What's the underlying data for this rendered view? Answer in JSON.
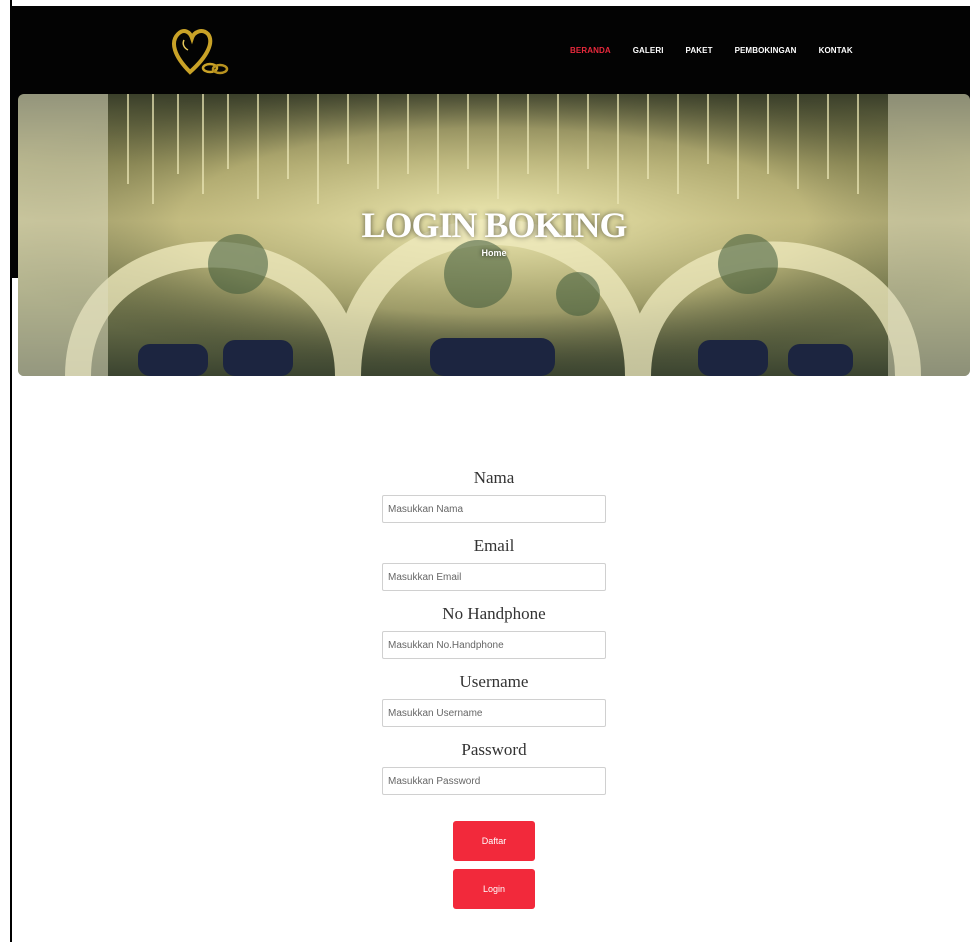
{
  "nav": {
    "items": [
      {
        "label": "BERANDA",
        "active": true
      },
      {
        "label": "GALERI",
        "active": false
      },
      {
        "label": "PAKET",
        "active": false
      },
      {
        "label": "PEMBOKINGAN",
        "active": false
      },
      {
        "label": "KONTAK",
        "active": false
      }
    ]
  },
  "logo": {
    "icon": "heart-rings-icon",
    "color": "#c9a227"
  },
  "hero": {
    "title": "LOGIN BOKING",
    "breadcrumb": "Home"
  },
  "form": {
    "fields": [
      {
        "label": "Nama",
        "placeholder": "Masukkan Nama"
      },
      {
        "label": "Email",
        "placeholder": "Masukkan Email"
      },
      {
        "label": "No Handphone",
        "placeholder": "Masukkan No.Handphone"
      },
      {
        "label": "Username",
        "placeholder": "Masukkan Username"
      },
      {
        "label": "Password",
        "placeholder": "Masukkan Password"
      }
    ],
    "daftar_label": "Daftar",
    "login_label": "Login"
  },
  "colors": {
    "accent": "#f2293b",
    "nav_active": "#e8293c",
    "header_bg": "#030303"
  }
}
